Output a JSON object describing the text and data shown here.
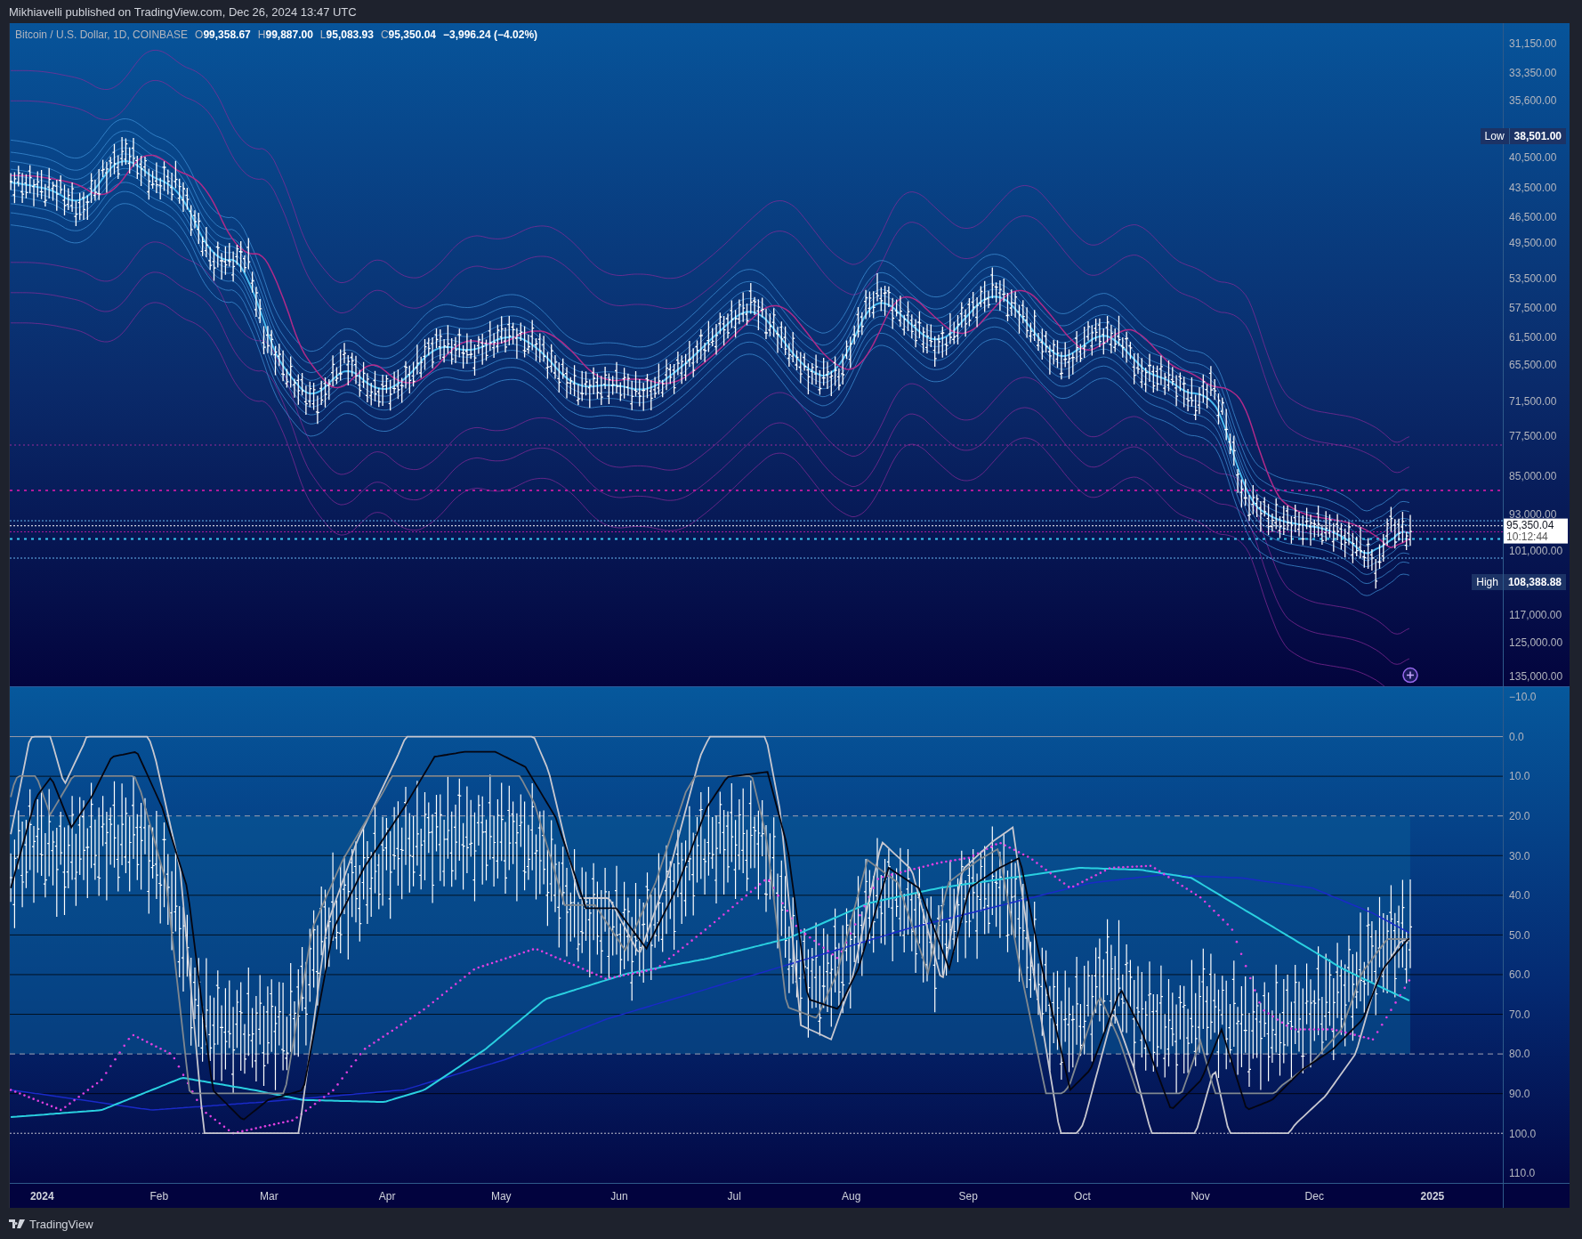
{
  "header": {
    "text": "Mikhiavelli published on TradingView.com, Dec 26, 2024 13:47 UTC"
  },
  "legend": {
    "symbol": "Bitcoin / U.S. Dollar, 1D, COINBASE",
    "values": [
      {
        "key": "O",
        "value": "99,358.67"
      },
      {
        "key": "H",
        "value": "99,887.00"
      },
      {
        "key": "L",
        "value": "95,083.93"
      },
      {
        "key": "C",
        "value": "95,350.04"
      }
    ],
    "change": "−3,996.24 (−4.02%)"
  },
  "price_axis": {
    "ticks": [
      "31,150.00",
      "33,350.00",
      "35,600.00",
      "40,500.00",
      "43,500.00",
      "46,500.00",
      "49,500.00",
      "53,500.00",
      "57,500.00",
      "61,500.00",
      "65,500.00",
      "71,500.00",
      "77,500.00",
      "85,000.00",
      "93,000.00",
      "101,000.00",
      "117,000.00",
      "125,000.00",
      "135,000.00"
    ]
  },
  "price_tags": [
    {
      "kind": "low",
      "label": "Low",
      "value": "38,501.00"
    },
    {
      "kind": "high",
      "label": "High",
      "value": "108,388.88"
    }
  ],
  "last_price": {
    "value": "95,350.04",
    "countdown": "10:12:44"
  },
  "oscillator_axis": {
    "ticks": [
      "−10.0",
      "0.0",
      "10.0",
      "20.0",
      "30.0",
      "40.0",
      "50.0",
      "60.0",
      "70.0",
      "80.0",
      "90.0",
      "100.0",
      "110.0"
    ]
  },
  "time_axis": {
    "ticks": [
      "2024",
      "Feb",
      "Mar",
      "Apr",
      "May",
      "Jun",
      "Jul",
      "Aug",
      "Sep",
      "Oct",
      "Nov",
      "Dec",
      "2025"
    ]
  },
  "footer": {
    "brand": "TradingView"
  }
}
